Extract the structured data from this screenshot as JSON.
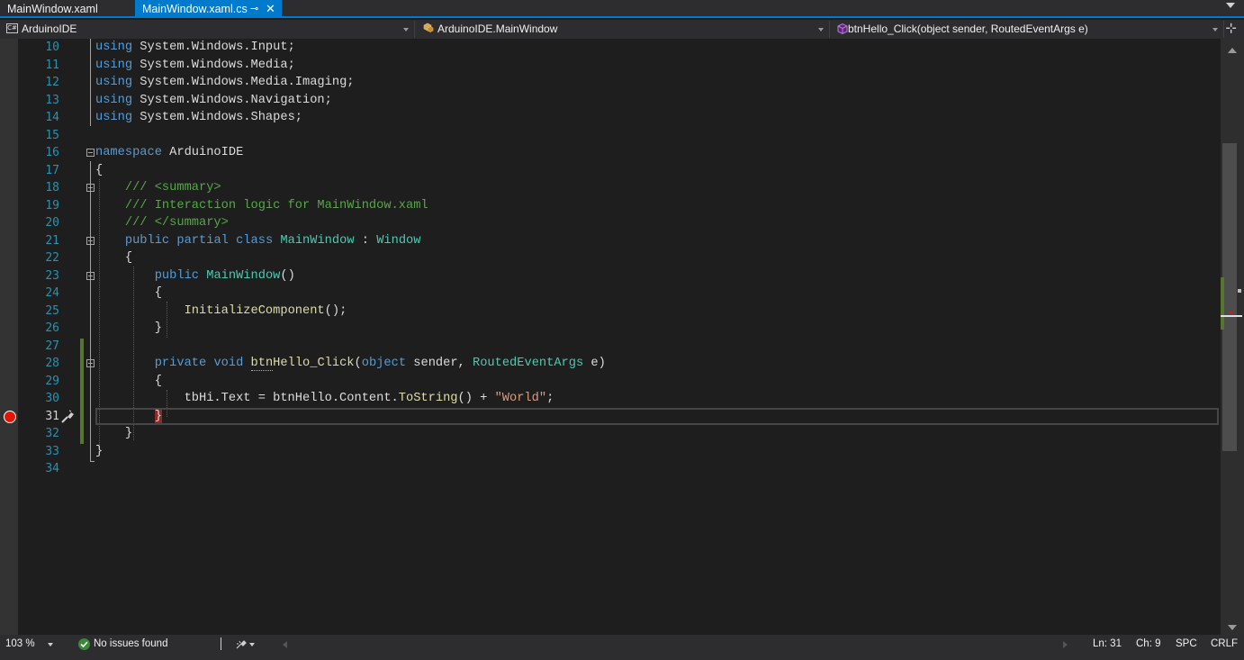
{
  "tabs": [
    {
      "label": "MainWindow.xaml",
      "active": false
    },
    {
      "label": "MainWindow.xaml.cs",
      "active": true
    }
  ],
  "tab_pin_glyph": "⊸",
  "tab_close_glyph": "✕",
  "navigation": {
    "project": "ArduinoIDE",
    "project_icon_text": "C#",
    "type": "ArduinoIDE.MainWindow",
    "member": "btnHello_Click(object sender, RoutedEventArgs e)"
  },
  "split_glyph": "⊹",
  "lines": [
    {
      "num": "10",
      "html": "<span class=\"kw\">using</span> System.Windows.Input;"
    },
    {
      "num": "11",
      "html": "<span class=\"kw\">using</span> System.Windows.Media;"
    },
    {
      "num": "12",
      "html": "<span class=\"kw\">using</span> System.Windows.Media.Imaging;"
    },
    {
      "num": "13",
      "html": "<span class=\"kw\">using</span> System.Windows.Navigation;"
    },
    {
      "num": "14",
      "html": "<span class=\"kw\">using</span> System.Windows.Shapes;"
    },
    {
      "num": "15",
      "html": ""
    },
    {
      "num": "16",
      "html": "<span class=\"kw\">namespace</span> ArduinoIDE"
    },
    {
      "num": "17",
      "html": "{"
    },
    {
      "num": "18",
      "html": "    <span class=\"cm\">/// &lt;summary&gt;</span>"
    },
    {
      "num": "19",
      "html": "    <span class=\"cm\">/// Interaction logic for MainWindow.xaml</span>"
    },
    {
      "num": "20",
      "html": "    <span class=\"cm\">/// &lt;/summary&gt;</span>"
    },
    {
      "num": "21",
      "html": "    <span class=\"kw\">public</span> <span class=\"kw\">partial</span> <span class=\"kw\">class</span> <span class=\"ty\">MainWindow</span> : <span class=\"ty\">Window</span>"
    },
    {
      "num": "22",
      "html": "    {"
    },
    {
      "num": "23",
      "html": "        <span class=\"kw\">public</span> <span class=\"ty\">MainWindow</span>()"
    },
    {
      "num": "24",
      "html": "        {"
    },
    {
      "num": "25",
      "html": "            <span class=\"fn\">InitializeComponent</span>();"
    },
    {
      "num": "26",
      "html": "        }"
    },
    {
      "num": "27",
      "html": ""
    },
    {
      "num": "28",
      "html": "        <span class=\"kw\">private</span> <span class=\"kw\">void</span> <span class=\"fn\"><span class=\"squiggle\">btn</span>Hello_Click</span>(<span class=\"kw\">object</span> sender, <span class=\"ty\">RoutedEventArgs</span> e)"
    },
    {
      "num": "29",
      "html": "        {"
    },
    {
      "num": "30",
      "html": "            tbHi.Text = btnHello.Content.<span class=\"fn\">ToString</span>() + <span class=\"str\">\"World\"</span>;"
    },
    {
      "num": "31",
      "html": "        <span class=\"caret-brace\">}</span>"
    },
    {
      "num": "32",
      "html": "    }"
    },
    {
      "num": "33",
      "html": "}"
    },
    {
      "num": "34",
      "html": ""
    }
  ],
  "current_line": "31",
  "breakpoint_line": "31",
  "status": {
    "zoom": "103 %",
    "issues": "No issues found",
    "line": "Ln: 31",
    "column": "Ch: 9",
    "whitespace": "SPC",
    "line_ending": "CRLF"
  },
  "colors": {
    "accent": "#007acc",
    "keyword": "#569cd6",
    "type": "#4ec9b0",
    "comment": "#57a64a",
    "string": "#d69d85",
    "method": "#dcdcaa",
    "line_number": "#2b91af",
    "breakpoint": "#e51400",
    "change_bar": "#577430"
  }
}
